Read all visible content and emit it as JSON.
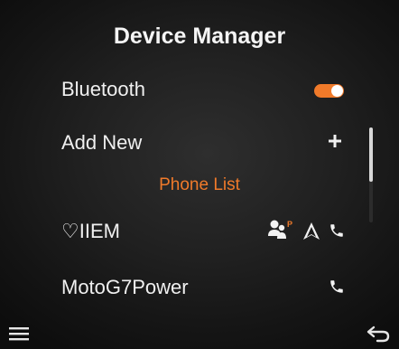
{
  "header": {
    "title": "Device Manager"
  },
  "menu": {
    "bluetooth": {
      "label": "Bluetooth",
      "enabled": true,
      "toggle_color": "#f07a2a"
    },
    "add_new": {
      "label": "Add New",
      "icon": "plus-icon"
    }
  },
  "phone_list": {
    "header": "Phone List",
    "header_color": "#f07a2a",
    "devices": [
      {
        "name": "♡IIEM",
        "icons": [
          "contacts-icon",
          "navigation-icon",
          "phone-icon"
        ],
        "contacts_badge": "P"
      },
      {
        "name": "MotoG7Power",
        "icons": [
          "phone-icon"
        ]
      }
    ]
  },
  "footer": {
    "left_icon": "menu-icon",
    "right_icon": "back-icon"
  }
}
